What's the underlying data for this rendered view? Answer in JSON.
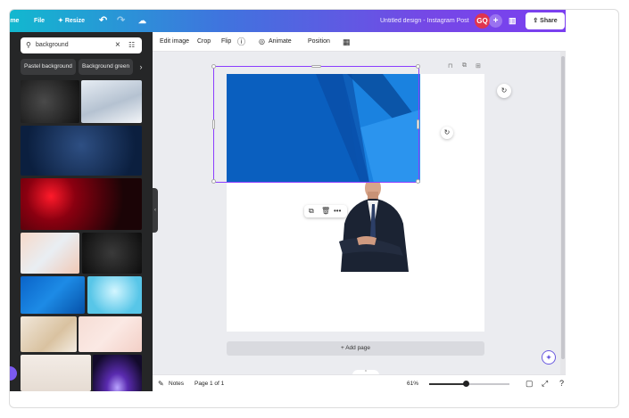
{
  "topbar": {
    "home_label": "Home",
    "file_label": "File",
    "resize_label": "Resize",
    "doc_title": "Untitled design - Instagram Post",
    "avatar_initials": "GQ",
    "share_label": "Share",
    "gradient_start": "#12b8cf",
    "gradient_end": "#7b3ff0"
  },
  "search": {
    "value": "background",
    "icon": "search-icon"
  },
  "chips": [
    "Pastel background",
    "Background green"
  ],
  "context_toolbar": {
    "edit_image": "Edit image",
    "crop": "Crop",
    "flip": "Flip",
    "animate": "Animate",
    "position": "Position"
  },
  "canvas": {
    "add_page_label": "+ Add page"
  },
  "bottombar": {
    "notes_label": "Notes",
    "page_label": "Page 1 of 1",
    "zoom_label": "61%",
    "zoom_fraction": 0.45
  },
  "colors": {
    "accent": "#8b3dff",
    "panel_bg": "#252627",
    "avatar_bg": "#e0344f"
  }
}
